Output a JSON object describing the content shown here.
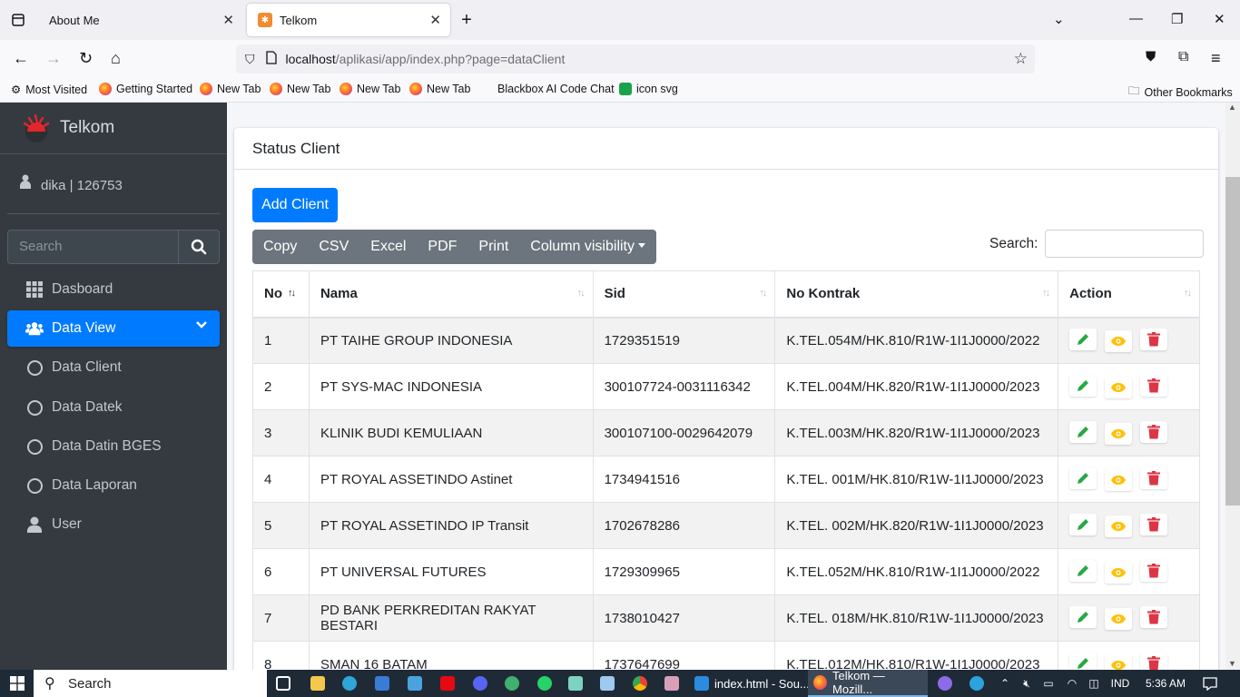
{
  "browser": {
    "tabs": [
      {
        "title": "About Me",
        "active": false
      },
      {
        "title": "Telkom",
        "active": true
      }
    ],
    "url_host": "localhost",
    "url_path": "/aplikasi/app/index.php?page=dataClient",
    "bookmarks": [
      "Most Visited",
      "Getting Started",
      "New Tab",
      "New Tab",
      "New Tab",
      "New Tab",
      "Blackbox AI Code Chat",
      "icon svg"
    ],
    "other_bookmarks": "Other Bookmarks"
  },
  "app": {
    "brand": "Telkom",
    "user": "dika | 126753",
    "search_placeholder": "Search",
    "menu": [
      {
        "label": "Dasboard",
        "icon": "dashboard-grid-icon"
      },
      {
        "label": "Data View",
        "icon": "users-icon",
        "active": true
      },
      {
        "label": "Data Client",
        "icon": "circle-icon"
      },
      {
        "label": "Data Datek",
        "icon": "circle-icon"
      },
      {
        "label": "Data Datin BGES",
        "icon": "circle-icon"
      },
      {
        "label": "Data Laporan",
        "icon": "circle-icon"
      },
      {
        "label": "User",
        "icon": "user-icon"
      }
    ]
  },
  "page": {
    "title": "Status Client",
    "add_button": "Add Client",
    "export_buttons": [
      "Copy",
      "CSV",
      "Excel",
      "PDF",
      "Print",
      "Column visibility"
    ],
    "search_label": "Search:",
    "columns": [
      "No",
      "Nama",
      "Sid",
      "No Kontrak",
      "Action"
    ],
    "rows": [
      {
        "no": "1",
        "nama": "PT TAIHE GROUP INDONESIA",
        "sid": "1729351519",
        "kontrak": "K.TEL.054M/HK.810/R1W-1I1J0000/2022"
      },
      {
        "no": "2",
        "nama": "PT SYS-MAC INDONESIA",
        "sid": "300107724-0031116342",
        "kontrak": "K.TEL.004M/HK.820/R1W-1I1J0000/2023"
      },
      {
        "no": "3",
        "nama": "KLINIK BUDI KEMULIAAN",
        "sid": "300107100-0029642079",
        "kontrak": "K.TEL.003M/HK.820/R1W-1I1J0000/2023"
      },
      {
        "no": "4",
        "nama": "PT ROYAL ASSETINDO Astinet",
        "sid": "1734941516",
        "kontrak": "K.TEL. 001M/HK.810/R1W-1I1J0000/2023"
      },
      {
        "no": "5",
        "nama": "PT ROYAL ASSETINDO IP Transit",
        "sid": "1702678286",
        "kontrak": "K.TEL. 002M/HK.820/R1W-1I1J0000/2023"
      },
      {
        "no": "6",
        "nama": "PT UNIVERSAL FUTURES",
        "sid": "1729309965",
        "kontrak": "K.TEL.052M/HK.810/R1W-1I1J0000/2022"
      },
      {
        "no": "7",
        "nama": "PD BANK PERKREDITAN RAKYAT BESTARI",
        "sid": "1738010427",
        "kontrak": "K.TEL. 018M/HK.810/R1W-1I1J0000/2023"
      },
      {
        "no": "8",
        "nama": "SMAN 16 BATAM",
        "sid": "1737647699",
        "kontrak": "K.TEL.012M/HK.810/R1W-1I1J0000/2023"
      }
    ]
  },
  "taskbar": {
    "search": "Search",
    "tasks": [
      "index.html - Sou...",
      "Telkom — Mozill..."
    ],
    "lang": "IND",
    "time": "5:36 AM"
  },
  "colors": {
    "primary": "#007bff",
    "sidebar": "#343a40",
    "edit": "#28a745",
    "view": "#ffc107",
    "delete": "#dc3545"
  }
}
